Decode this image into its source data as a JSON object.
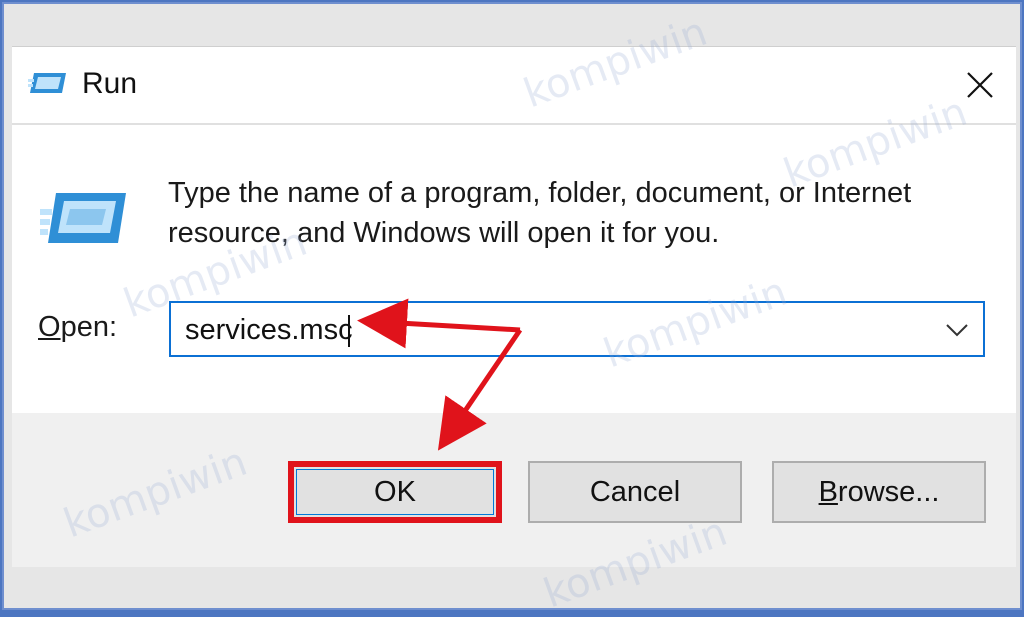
{
  "window": {
    "title": "Run",
    "prompt_line1": "Type the name of a program, folder, document, or Internet",
    "prompt_line2": "resource, and Windows will open it for you.",
    "open_label_underlined": "O",
    "open_label_rest": "pen:",
    "open_value": "services.msc"
  },
  "buttons": {
    "ok": "OK",
    "cancel": "Cancel",
    "browse_underlined": "B",
    "browse_rest": "rowse..."
  },
  "watermark": "kompiwin",
  "colors": {
    "highlight": "#e0131b",
    "focus_border": "#0b70d4",
    "frame": "#4d76c1"
  },
  "icons": [
    "run-app-icon",
    "close-icon",
    "chevron-down-icon",
    "arrow-annotation"
  ]
}
